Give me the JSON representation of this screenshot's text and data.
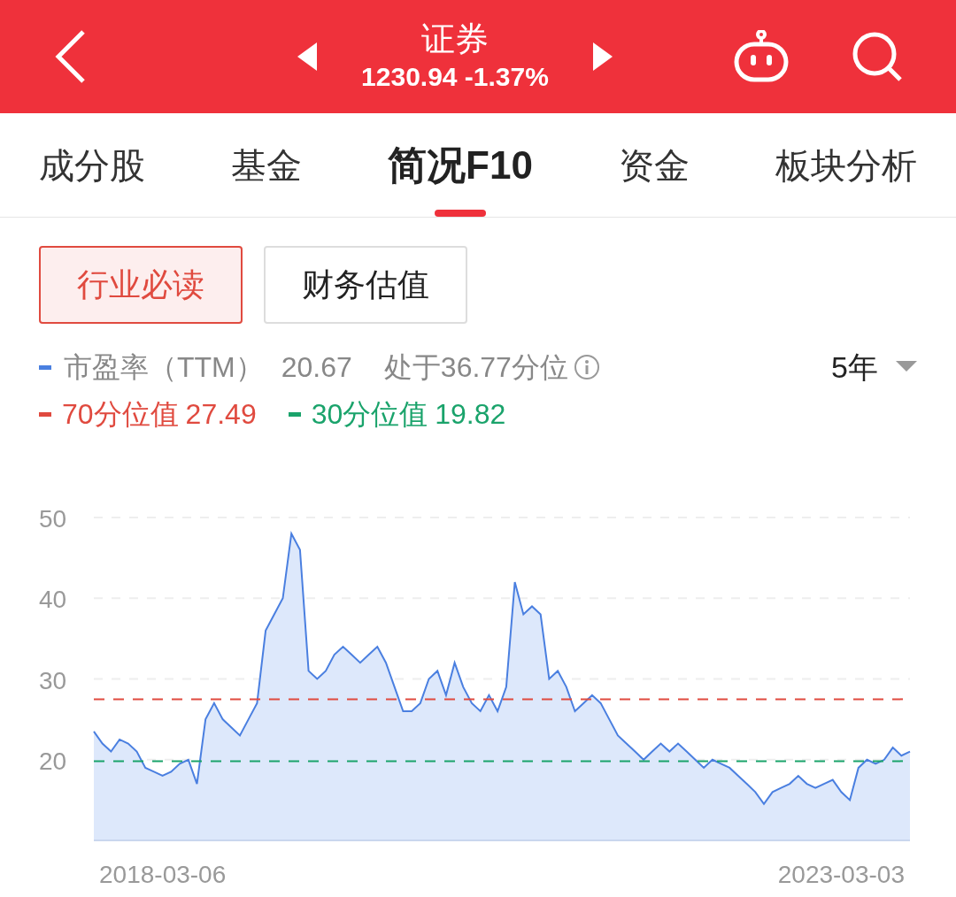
{
  "header": {
    "title": "证券",
    "quote": "1230.94 -1.37%"
  },
  "tabs": [
    {
      "label": "成分股",
      "selected": false
    },
    {
      "label": "基金",
      "selected": false
    },
    {
      "label": "简况F10",
      "selected": true
    },
    {
      "label": "资金",
      "selected": false
    },
    {
      "label": "板块分析",
      "selected": false
    }
  ],
  "segments": [
    {
      "label": "行业必读",
      "selected": true
    },
    {
      "label": "财务估值",
      "selected": false
    }
  ],
  "legend": {
    "items": [
      {
        "value": "20.67",
        "color": "#4a7fe0"
      },
      {
        "label": "70分位值",
        "value": "27.49",
        "color": "#e04a3f"
      },
      {
        "label": "30分位值",
        "value": "19.82",
        "color": "#1aa36b"
      }
    ],
    "percentile": "处于36.77分位",
    "period": "5年"
  },
  "chart_data": {
    "type": "area",
    "categories": [
      null,
      null,
      null,
      null,
      null,
      null,
      null,
      null,
      "2018-03-06",
      null,
      null,
      null,
      null,
      null,
      null,
      null,
      null,
      null,
      null,
      null,
      null,
      null,
      null,
      null,
      null,
      null,
      null,
      null,
      null,
      null,
      null,
      null,
      null,
      null,
      null,
      null,
      null,
      null,
      null,
      null,
      null,
      null,
      null,
      null,
      null,
      null,
      null,
      null,
      null,
      null,
      null,
      null,
      null,
      null,
      null,
      null,
      null,
      null,
      null,
      null,
      null,
      null,
      null,
      null,
      null,
      null,
      null,
      null,
      null,
      null,
      null,
      null,
      null,
      null,
      null,
      null,
      null,
      null,
      null,
      null,
      null,
      null,
      null,
      null,
      null,
      null,
      null,
      "2023-03-03",
      null,
      null,
      null,
      null,
      null,
      null,
      null,
      null
    ],
    "ylim": [
      10,
      50
    ],
    "yticks": [
      20,
      30,
      40,
      50
    ],
    "grid": true,
    "ref_lines": [
      {
        "axis": "y",
        "value": 27.49,
        "color": "#e04a3f"
      },
      {
        "axis": "y",
        "value": 19.82,
        "color": "#1aa36b"
      }
    ],
    "series": [
      {
        "name": "市盈率（TTM）",
        "color": "#4a7fe0",
        "values": [
          23.5,
          22,
          21,
          22.5,
          22,
          21,
          19,
          18.5,
          18,
          18.5,
          19.5,
          20,
          17,
          25,
          27,
          25,
          24,
          23,
          25,
          27,
          36,
          38,
          40,
          48,
          46,
          31,
          30,
          31,
          33,
          34,
          33,
          32,
          33,
          34,
          32,
          29,
          26,
          26,
          27,
          30,
          31,
          28,
          32,
          29,
          27,
          26,
          28,
          26,
          29,
          42,
          38,
          39,
          38,
          30,
          31,
          29,
          26,
          27,
          28,
          27,
          25,
          23,
          22,
          21,
          20,
          21,
          22,
          21,
          22,
          21,
          20,
          19,
          20,
          19.5,
          19,
          18,
          17,
          16,
          14.5,
          16,
          16.5,
          17,
          18,
          17,
          16.5,
          17,
          17.5,
          16,
          15,
          19,
          20,
          19.5,
          20,
          21.5,
          20.5,
          21
        ]
      }
    ]
  }
}
